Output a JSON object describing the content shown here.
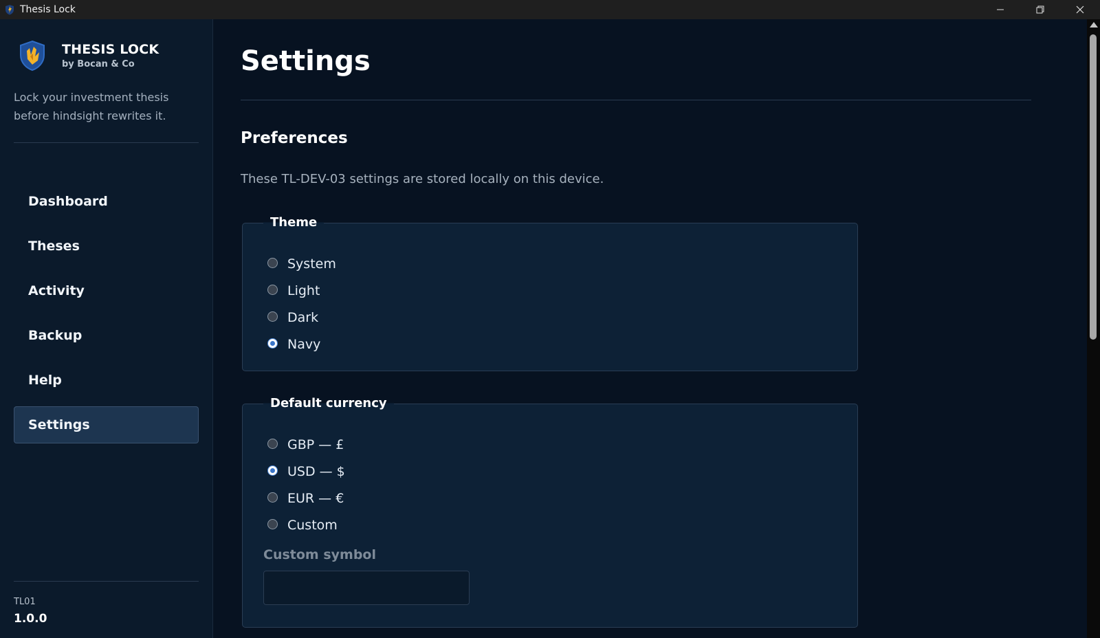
{
  "window": {
    "title": "Thesis Lock",
    "icon": "app-shield-icon"
  },
  "sidebar": {
    "brand_name": "THESIS LOCK",
    "brand_sub": "by Bocan & Co",
    "tagline": "Lock your investment thesis before hindsight rewrites it.",
    "nav": [
      {
        "label": "Dashboard",
        "active": false
      },
      {
        "label": "Theses",
        "active": false
      },
      {
        "label": "Activity",
        "active": false
      },
      {
        "label": "Backup",
        "active": false
      },
      {
        "label": "Help",
        "active": false
      },
      {
        "label": "Settings",
        "active": true
      }
    ],
    "version_label": "TL01",
    "version": "1.0.0"
  },
  "main": {
    "title": "Settings",
    "section_title": "Preferences",
    "section_desc": "These TL-DEV-03 settings are stored locally on this device.",
    "theme": {
      "legend": "Theme",
      "options": [
        {
          "label": "System",
          "checked": false
        },
        {
          "label": "Light",
          "checked": false
        },
        {
          "label": "Dark",
          "checked": false
        },
        {
          "label": "Navy",
          "checked": true
        }
      ]
    },
    "currency": {
      "legend": "Default currency",
      "options": [
        {
          "label": "GBP — £",
          "checked": false
        },
        {
          "label": "USD — $",
          "checked": true
        },
        {
          "label": "EUR — €",
          "checked": false
        },
        {
          "label": "Custom",
          "checked": false
        }
      ],
      "custom_symbol_label": "Custom symbol",
      "custom_symbol_value": ""
    }
  },
  "colors": {
    "background": "#071221",
    "sidebar": "#0b1a2b",
    "panel": "#0d2136",
    "accent": "#3b76c9",
    "active_nav": "#1d3550"
  }
}
